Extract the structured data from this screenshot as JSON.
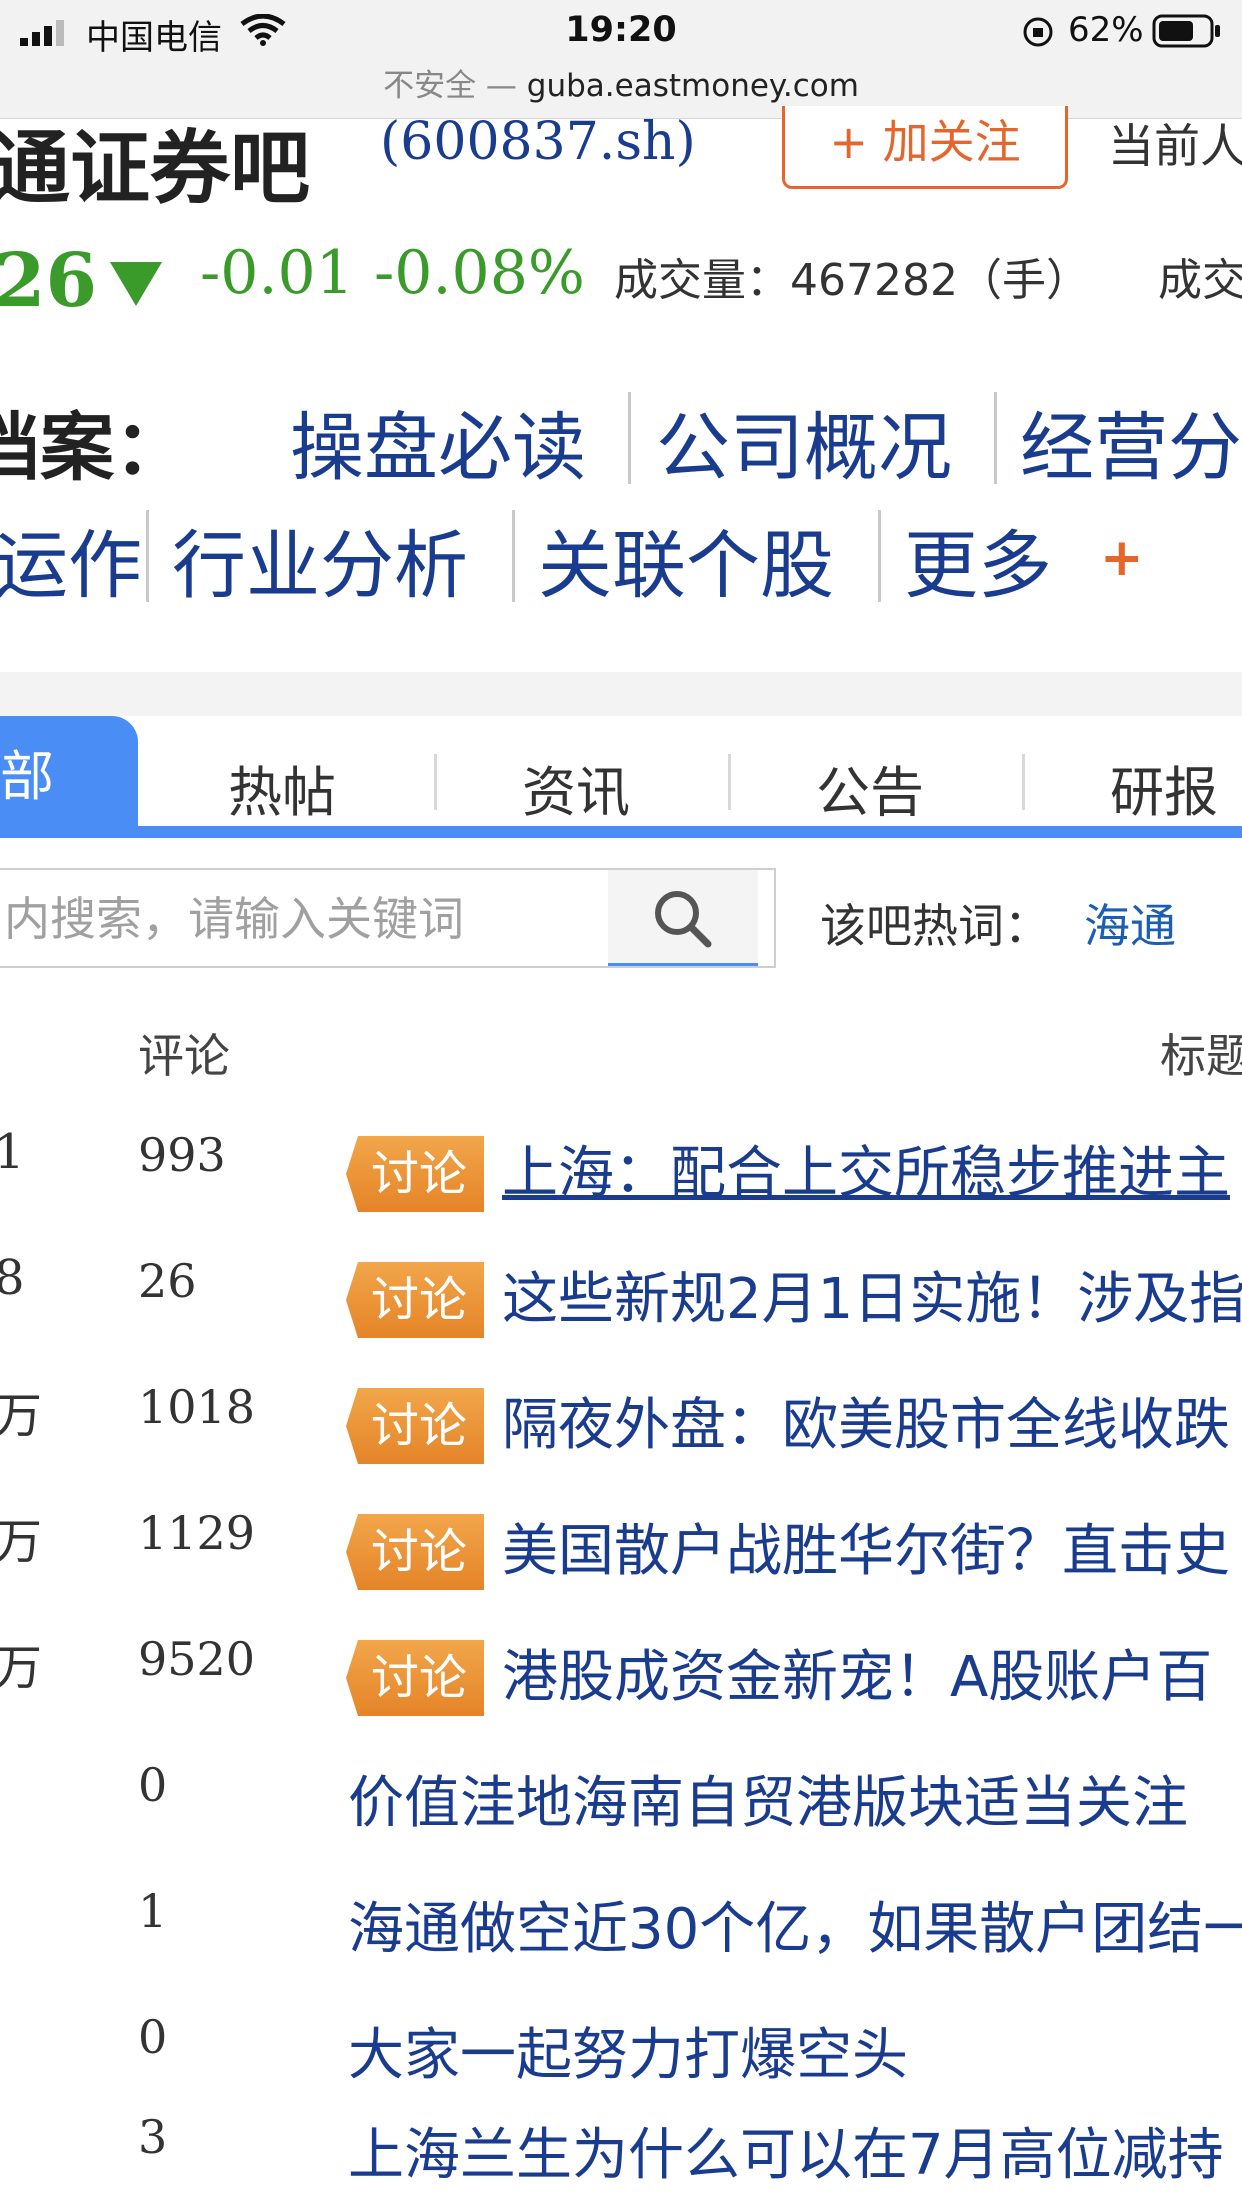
{
  "status_bar": {
    "carrier": "中国电信",
    "time": "19:20",
    "battery": "62%",
    "url_prefix": "不安全 —",
    "url": "guba.eastmoney.com"
  },
  "header": {
    "bar_name": "通证券吧",
    "stock_code": "(600837.sh)",
    "follow_label": "+ 加关注",
    "current_people": "当前人"
  },
  "quote": {
    "price": "26",
    "change": "-0.01",
    "change_pct": "-0.08%",
    "volume": "成交量：467282（手）",
    "turnover": "成交"
  },
  "archive": {
    "label": "档案：",
    "row1": [
      "操盘必读",
      "公司概况",
      "经营分"
    ],
    "row2": [
      "运作",
      "行业分析",
      "关联个股",
      "更多"
    ],
    "more_icon": "+"
  },
  "tabs": {
    "active": "部",
    "items": [
      "热帖",
      "资讯",
      "公告",
      "研报"
    ]
  },
  "search": {
    "placeholder": "内搜索，请输入关键词",
    "hot_label": "该吧热词：",
    "hot_word": "海通"
  },
  "list": {
    "col_comments": "评论",
    "col_title": "标题",
    "rows": [
      {
        "read": "1",
        "comments": "993",
        "tag": "讨论",
        "title": "上海：配合上交所稳步推进主"
      },
      {
        "read": "8",
        "comments": "26",
        "tag": "讨论",
        "title": "这些新规2月1日实施！涉及指"
      },
      {
        "read": "万",
        "comments": "1018",
        "tag": "讨论",
        "title": "隔夜外盘：欧美股市全线收跌"
      },
      {
        "read": "万",
        "comments": "1129",
        "tag": "讨论",
        "title": "美国散户战胜华尔街？直击史"
      },
      {
        "read": "万",
        "comments": "9520",
        "tag": "讨论",
        "title": "港股成资金新宠！A股账户百"
      },
      {
        "read": "",
        "comments": "0",
        "tag": "",
        "title": "价值洼地海南自贸港版块适当关注"
      },
      {
        "read": "",
        "comments": "1",
        "tag": "",
        "title": "海通做空近30个亿，如果散户团结一"
      },
      {
        "read": "",
        "comments": "0",
        "tag": "",
        "title": "大家一起努力打爆空头"
      },
      {
        "read": "",
        "comments": "3",
        "tag": "",
        "title": "上海兰生为什么可以在7月高位减持"
      }
    ]
  }
}
